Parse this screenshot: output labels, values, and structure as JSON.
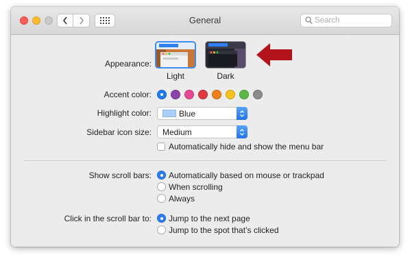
{
  "window": {
    "title": "General",
    "search_placeholder": "Search"
  },
  "appearance": {
    "label": "Appearance:",
    "options": [
      {
        "name": "Light",
        "selected": true
      },
      {
        "name": "Dark",
        "selected": false
      }
    ],
    "annotation_arrow_color": "#b3141b"
  },
  "accent": {
    "label": "Accent color:",
    "colors": [
      "#1f7af5",
      "#8e44ad",
      "#e84893",
      "#e0383e",
      "#f07f18",
      "#f7c21b",
      "#5ab946",
      "#8c8c8c"
    ],
    "selected_index": 0
  },
  "highlight": {
    "label": "Highlight color:",
    "value": "Blue",
    "swatch_color": "#aacff8"
  },
  "sidebar": {
    "label": "Sidebar icon size:",
    "value": "Medium"
  },
  "menubar": {
    "checkbox_label": "Automatically hide and show the menu bar",
    "checked": false
  },
  "scrollbars": {
    "label": "Show scroll bars:",
    "options": [
      {
        "label": "Automatically based on mouse or trackpad",
        "selected": true
      },
      {
        "label": "When scrolling",
        "selected": false
      },
      {
        "label": "Always",
        "selected": false
      }
    ]
  },
  "click_scroll": {
    "label": "Click in the scroll bar to:",
    "options": [
      {
        "label": "Jump to the next page",
        "selected": true
      },
      {
        "label": "Jump to the spot that’s clicked",
        "selected": false
      }
    ]
  }
}
